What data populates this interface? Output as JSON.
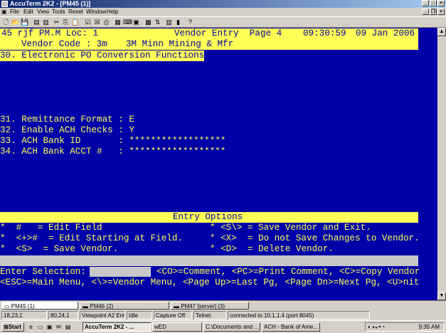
{
  "window": {
    "title": "AccuTerm 2K2 - [PM45 (1)]"
  },
  "menu": [
    "File",
    "Edit",
    "View",
    "Tools",
    "Reset",
    "Window",
    "Help"
  ],
  "terminal": {
    "header_left": "45 rjf PM.M Loc: 1",
    "header_title": "Vendor Entry  Page 4",
    "header_time": "09:30:59",
    "header_date": "09 Jan 2006",
    "vendor_label": "Vendor Code : 3m",
    "vendor_name": "3M Minn Mining & Mfr",
    "section": "30. Electronic PO Conversion Functions",
    "fields": [
      "31. Remittance Format : E",
      "32. Enable ACH Checks : Y",
      "33. ACH Bank ID       : ******************",
      "34. ACH Bank ACCT #   : ******************"
    ],
    "options_title": "Entry Options",
    "options": [
      {
        "left": "*  #   = Edit Field",
        "right": "* <S\\> = Save Vendor and Exit."
      },
      {
        "left": "*  <+>#  = Edit Starting at Field.",
        "right": "* <X>  = Do not Save Changes to Vendor."
      },
      {
        "left": "*  <S>  = Save Vendor.",
        "right": "* <D>  = Delete Vendor."
      }
    ],
    "prompt_label": "Enter Selection:",
    "prompt_help1": "<CO>=Comment, <PC>=Print Comment, <C>=Copy Vendor",
    "prompt_help2": "<ESC>=Main Menu, <\\>=Vendor Menu, <Page Up>=Last Pg, <Page Dn>=Next Pg, <U>nit"
  },
  "tabs": [
    "PM45 (1)",
    "PM46 (2)",
    "PM47 [server] (3)"
  ],
  "status": [
    "18,23,1",
    "80,24,1",
    "Viewpoint A2 Enh",
    "Idle",
    "Capture Off",
    "Telnet",
    "connected to 10.1.1.4 (port 8045)"
  ],
  "taskbar": {
    "start": "Start",
    "tasks": [
      "AccuTerm 2K2 - ...",
      "wED",
      "C:\\Documents and ...",
      "ACH - Bank of Ame..."
    ],
    "clock": "9:35 AM"
  }
}
